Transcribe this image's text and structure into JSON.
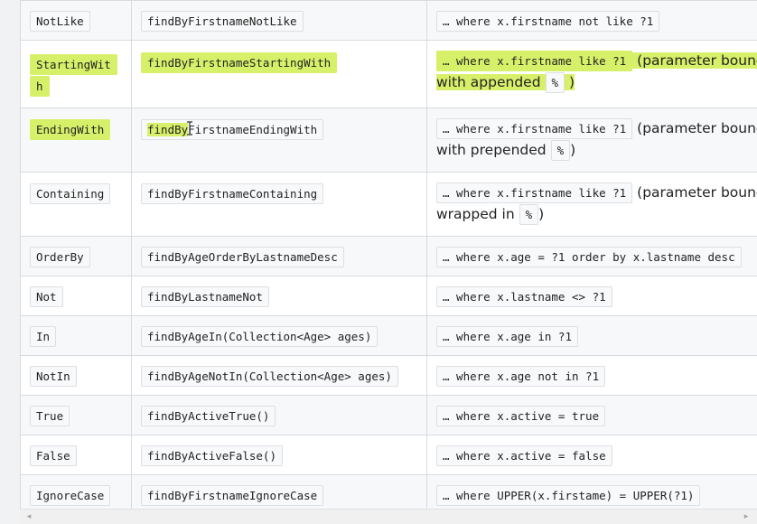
{
  "rows": [
    {
      "keyword": "NotLike",
      "sample": "findByFirstnameNotLike",
      "jpql": "… where x.firstname not like ?1",
      "note": "",
      "op": ""
    },
    {
      "keyword": "StartingWith",
      "sample": "findByFirstnameStartingWith",
      "jpql": "… where x.firstname like ?1",
      "note_pre": "(parameter bound with appended",
      "op": "%",
      "note_post": ")"
    },
    {
      "keyword": "EndingWith",
      "sample": "findByFirstnameEndingWith",
      "jpql": "… where x.firstname like ?1",
      "note_pre": "(parameter bound with prepended",
      "op": "%",
      "note_post": ")"
    },
    {
      "keyword": "Containing",
      "sample": "findByFirstnameContaining",
      "jpql": "… where x.firstname like ?1",
      "note_pre": "(parameter bound wrapped in",
      "op": "%",
      "note_post": ")"
    },
    {
      "keyword": "OrderBy",
      "sample": "findByAgeOrderByLastnameDesc",
      "jpql": "… where x.age = ?1 order by x.lastname desc"
    },
    {
      "keyword": "Not",
      "sample": "findByLastnameNot",
      "jpql": "… where x.lastname <> ?1"
    },
    {
      "keyword": "In",
      "sample": "findByAgeIn(Collection<Age> ages)",
      "jpql": "… where x.age in ?1"
    },
    {
      "keyword": "NotIn",
      "sample": "findByAgeNotIn(Collection<Age> ages)",
      "jpql": "… where x.age not in ?1"
    },
    {
      "keyword": "True",
      "sample": "findByActiveTrue()",
      "jpql": "… where x.active = true"
    },
    {
      "keyword": "False",
      "sample": "findByActiveFalse()",
      "jpql": "… where x.active = false"
    },
    {
      "keyword": "IgnoreCase",
      "sample": "findByFirstnameIgnoreCase",
      "jpql": "… where UPPER(x.firstame) = UPPER(?1)"
    }
  ],
  "highlight_color": "#d7f06a",
  "scrollbar": {
    "left_arrow": "◂",
    "right_arrow": "▸"
  },
  "split": {
    "ending_prefix": "findBy",
    "ending_suffix": "FirstnameEndingWith"
  }
}
